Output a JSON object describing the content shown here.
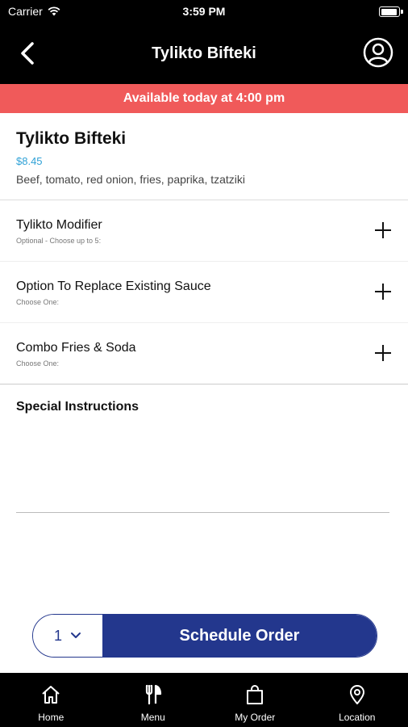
{
  "status_bar": {
    "carrier": "Carrier",
    "time": "3:59 PM"
  },
  "header": {
    "title": "Tylikto Bifteki",
    "back_icon": "chevron-left-icon",
    "account_icon": "user-circle-icon"
  },
  "banner": {
    "text": "Available today at 4:00 pm",
    "color": "#f05a5a"
  },
  "item": {
    "name": "Tylikto Bifteki",
    "price": "$8.45",
    "description": "Beef, tomato, red onion, fries, paprika, tzatziki",
    "price_color": "#2fa1d6"
  },
  "modifiers": [
    {
      "title": "Tylikto Modifier",
      "subtitle": "Optional - Choose up to 5:"
    },
    {
      "title": "Option To Replace Existing Sauce",
      "subtitle": "Choose One:"
    },
    {
      "title": "Combo Fries & Soda",
      "subtitle": "Choose One:"
    }
  ],
  "special_instructions": {
    "label": "Special Instructions",
    "value": ""
  },
  "order": {
    "quantity": "1",
    "button_label": "Schedule Order",
    "accent": "#23378d"
  },
  "tabs": [
    {
      "label": "Home",
      "icon": "home-icon"
    },
    {
      "label": "Menu",
      "icon": "fork-knife-icon"
    },
    {
      "label": "My Order",
      "icon": "shopping-bag-icon"
    },
    {
      "label": "Location",
      "icon": "map-pin-icon"
    }
  ]
}
